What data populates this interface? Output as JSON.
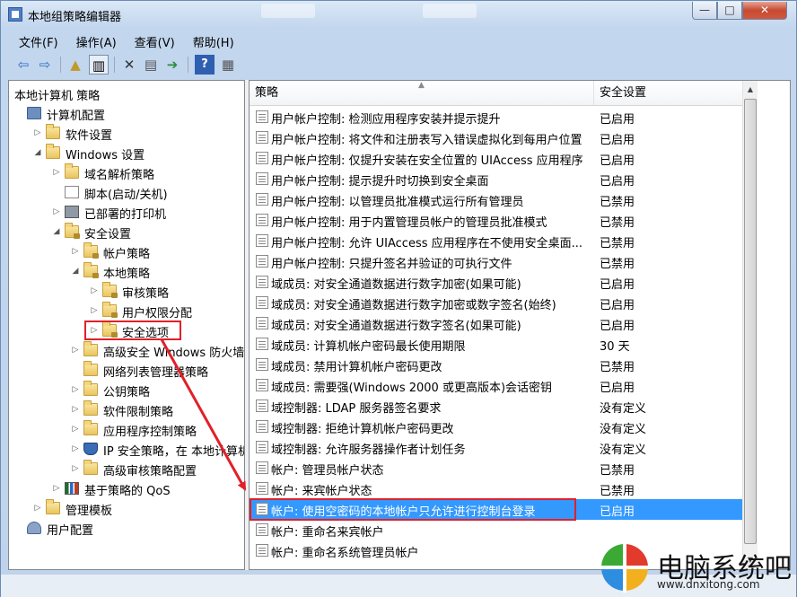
{
  "window": {
    "title": "本地组策略编辑器",
    "minimize": "—",
    "maximize": "□",
    "close": "✕"
  },
  "menu": [
    "文件(F)",
    "操作(A)",
    "查看(V)",
    "帮助(H)"
  ],
  "toolbar_icons": [
    "back-arrow-icon",
    "forward-arrow-icon",
    "up-folder-icon",
    "show-hide-tree-icon",
    "delete-x-icon",
    "properties-icon",
    "export-list-icon",
    "help-icon",
    "view-icon"
  ],
  "tree": {
    "header": "本地计算机 策略",
    "items": [
      {
        "label": "计算机配置",
        "icon": "computer",
        "twisty": ""
      },
      {
        "label": "软件设置",
        "icon": "folder",
        "twisty": "▷"
      },
      {
        "label": "Windows 设置",
        "icon": "folder",
        "twisty": "◢"
      },
      {
        "label": "域名解析策略",
        "icon": "folder",
        "twisty": "▷"
      },
      {
        "label": "脚本(启动/关机)",
        "icon": "doc",
        "twisty": ""
      },
      {
        "label": "已部署的打印机",
        "icon": "printer",
        "twisty": "▷"
      },
      {
        "label": "安全设置",
        "icon": "lockfolder",
        "twisty": "◢"
      },
      {
        "label": "帐户策略",
        "icon": "lockfolder",
        "twisty": "▷"
      },
      {
        "label": "本地策略",
        "icon": "lockfolder",
        "twisty": "◢"
      },
      {
        "label": "审核策略",
        "icon": "lockfolder",
        "twisty": "▷"
      },
      {
        "label": "用户权限分配",
        "icon": "lockfolder",
        "twisty": "▷"
      },
      {
        "label": "安全选项",
        "icon": "lockfolder",
        "twisty": "▷"
      },
      {
        "label": "高级安全 Windows 防火墙",
        "icon": "folder",
        "twisty": "▷"
      },
      {
        "label": "网络列表管理器策略",
        "icon": "folder",
        "twisty": ""
      },
      {
        "label": "公钥策略",
        "icon": "folder",
        "twisty": "▷"
      },
      {
        "label": "软件限制策略",
        "icon": "folder",
        "twisty": "▷"
      },
      {
        "label": "应用程序控制策略",
        "icon": "folder",
        "twisty": "▷"
      },
      {
        "label": "IP 安全策略，在 本地计算机",
        "icon": "netshield",
        "twisty": "▷"
      },
      {
        "label": "高级审核策略配置",
        "icon": "folder",
        "twisty": "▷"
      },
      {
        "label": "基于策略的 QoS",
        "icon": "barchart",
        "twisty": "▷"
      },
      {
        "label": "管理模板",
        "icon": "folder",
        "twisty": "▷"
      },
      {
        "label": "用户配置",
        "icon": "user",
        "twisty": ""
      }
    ]
  },
  "list": {
    "col_policy": "策略",
    "col_setting": "安全设置",
    "rows": [
      {
        "policy": "用户帐户控制: 检测应用程序安装并提示提升",
        "value": "已启用"
      },
      {
        "policy": "用户帐户控制: 将文件和注册表写入错误虚拟化到每用户位置",
        "value": "已启用"
      },
      {
        "policy": "用户帐户控制: 仅提升安装在安全位置的 UIAccess 应用程序",
        "value": "已启用"
      },
      {
        "policy": "用户帐户控制: 提示提升时切换到安全桌面",
        "value": "已启用"
      },
      {
        "policy": "用户帐户控制: 以管理员批准模式运行所有管理员",
        "value": "已禁用"
      },
      {
        "policy": "用户帐户控制: 用于内置管理员帐户的管理员批准模式",
        "value": "已禁用"
      },
      {
        "policy": "用户帐户控制: 允许 UIAccess 应用程序在不使用安全桌面...",
        "value": "已禁用"
      },
      {
        "policy": "用户帐户控制: 只提升签名并验证的可执行文件",
        "value": "已禁用"
      },
      {
        "policy": "域成员: 对安全通道数据进行数字加密(如果可能)",
        "value": "已启用"
      },
      {
        "policy": "域成员: 对安全通道数据进行数字加密或数字签名(始终)",
        "value": "已启用"
      },
      {
        "policy": "域成员: 对安全通道数据进行数字签名(如果可能)",
        "value": "已启用"
      },
      {
        "policy": "域成员: 计算机帐户密码最长使用期限",
        "value": "30 天"
      },
      {
        "policy": "域成员: 禁用计算机帐户密码更改",
        "value": "已禁用"
      },
      {
        "policy": "域成员: 需要强(Windows 2000 或更高版本)会话密钥",
        "value": "已启用"
      },
      {
        "policy": "域控制器: LDAP 服务器签名要求",
        "value": "没有定义"
      },
      {
        "policy": "域控制器: 拒绝计算机帐户密码更改",
        "value": "没有定义"
      },
      {
        "policy": "域控制器: 允许服务器操作者计划任务",
        "value": "没有定义"
      },
      {
        "policy": "帐户: 管理员帐户状态",
        "value": "已禁用"
      },
      {
        "policy": "帐户: 来宾帐户状态",
        "value": "已禁用"
      },
      {
        "policy": "帐户: 使用空密码的本地帐户只允许进行控制台登录",
        "value": "已启用"
      },
      {
        "policy": "帐户: 重命名来宾帐户",
        "value": ""
      },
      {
        "policy": "帐户: 重命名系统管理员帐户",
        "value": ""
      }
    ]
  },
  "watermark": {
    "text": "电脑系统吧",
    "url": "www.dnxitong.com"
  },
  "colors": {
    "selection": "#3399ff",
    "annotation": "#e0202a"
  }
}
